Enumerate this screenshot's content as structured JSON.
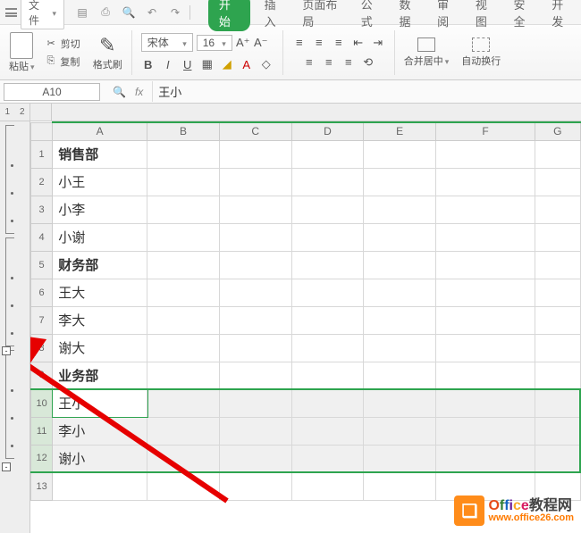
{
  "menu": {
    "file": "文件",
    "tabs": [
      "开始",
      "插入",
      "页面布局",
      "公式",
      "数据",
      "审阅",
      "视图",
      "安全",
      "开发"
    ]
  },
  "clipboard": {
    "paste": "粘贴",
    "cut": "剪切",
    "copy": "复制",
    "format_painter": "格式刷"
  },
  "font": {
    "name": "宋体",
    "size": "16"
  },
  "alignment": {
    "merge": "合并居中",
    "wrap": "自动换行"
  },
  "namebox": "A10",
  "formula": "王小",
  "outline_levels": [
    "1",
    "2"
  ],
  "columns": [
    "A",
    "B",
    "C",
    "D",
    "E",
    "F",
    "G"
  ],
  "rows": [
    {
      "n": "1",
      "val": "销售部",
      "bold": true
    },
    {
      "n": "2",
      "val": "小王",
      "bold": false
    },
    {
      "n": "3",
      "val": "小李",
      "bold": false
    },
    {
      "n": "4",
      "val": "小谢",
      "bold": false
    },
    {
      "n": "5",
      "val": "财务部",
      "bold": true
    },
    {
      "n": "6",
      "val": "王大",
      "bold": false
    },
    {
      "n": "7",
      "val": "李大",
      "bold": false
    },
    {
      "n": "8",
      "val": "谢大",
      "bold": false
    },
    {
      "n": "9",
      "val": "业务部",
      "bold": true
    },
    {
      "n": "10",
      "val": "王小",
      "bold": false
    },
    {
      "n": "11",
      "val": "李小",
      "bold": false
    },
    {
      "n": "12",
      "val": "谢小",
      "bold": false
    },
    {
      "n": "13",
      "val": "",
      "bold": false
    }
  ],
  "watermark": {
    "brand": "Office",
    "brand_cn": "教程网",
    "url": "www.office26.com"
  }
}
